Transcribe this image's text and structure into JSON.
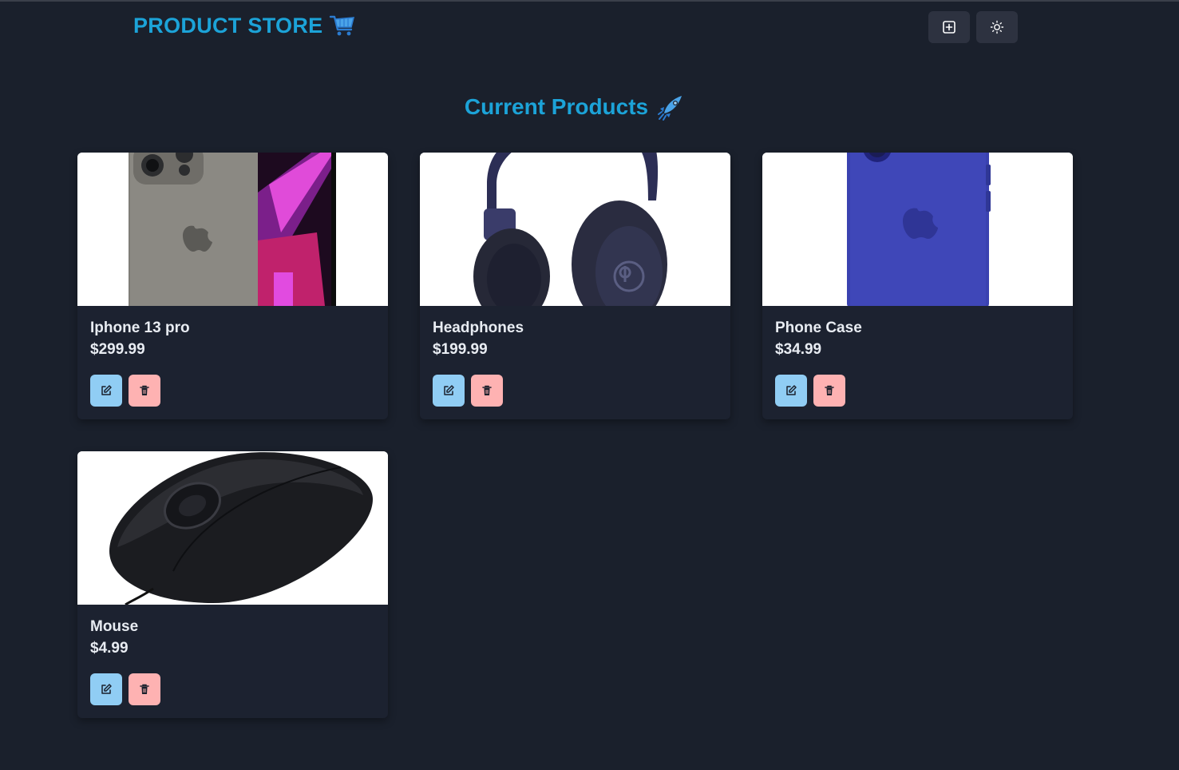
{
  "navbar": {
    "brand": "PRODUCT STORE",
    "brand_icon": "shopping-cart-icon",
    "buttons": [
      {
        "icon": "plus-square-icon"
      },
      {
        "icon": "sun-icon"
      }
    ]
  },
  "main": {
    "heading": "Current Products",
    "heading_icon": "rocket-icon"
  },
  "products": [
    {
      "name": "Iphone 13 pro",
      "price": "$299.99",
      "image": "iphone-image"
    },
    {
      "name": "Headphones",
      "price": "$199.99",
      "image": "headphones-image"
    },
    {
      "name": "Phone Case",
      "price": "$34.99",
      "image": "phone-case-image"
    },
    {
      "name": "Mouse",
      "price": "$4.99",
      "image": "mouse-image"
    }
  ],
  "colors": {
    "background": "#1a202c",
    "accent": "#1ca3d8",
    "edit_button": "#90cdf4",
    "delete_button": "#feb2b2"
  }
}
